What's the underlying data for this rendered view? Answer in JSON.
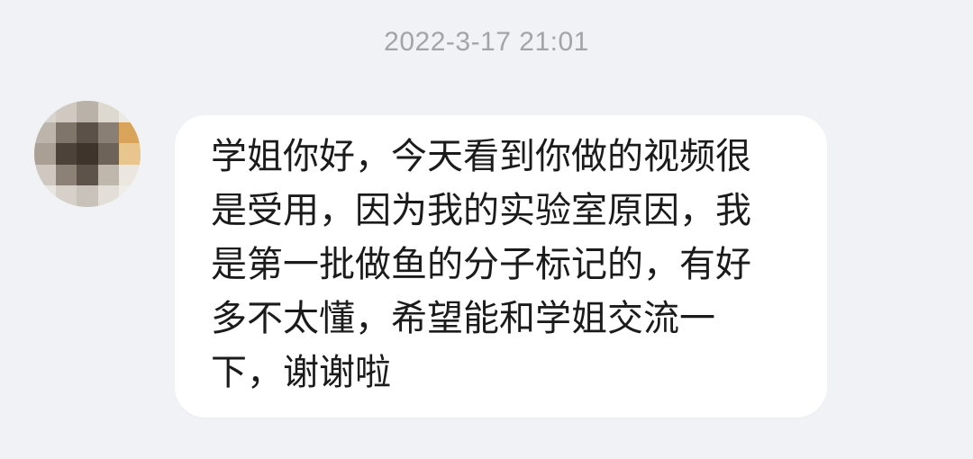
{
  "chat": {
    "timestamp": "2022-3-17 21:01",
    "message": {
      "lines": [
        "学姐你好，今天看到你做的视频很",
        "是受用，因为我的实验室原因，我",
        "是第一批做鱼的分子标记的，有好",
        "多不太懂，希望能和学姐交流一",
        "下，谢谢啦"
      ]
    },
    "avatar": {
      "icon": "pixelated-avatar-icon",
      "mosaic_colors": [
        "#d8d4cf",
        "#cfc9c1",
        "#b9b2a8",
        "#ddd8d0",
        "#ece8e2",
        "#bdb5ab",
        "#7f756b",
        "#5c5148",
        "#8a7f74",
        "#d9a45a",
        "#a99f95",
        "#4d4239",
        "#3f342c",
        "#6e6358",
        "#e8c58c",
        "#cfc8c0",
        "#8b8177",
        "#5e534a",
        "#bfb6ac",
        "#ebe6df",
        "#e9e5e0",
        "#d6d0c9",
        "#c9c2ba",
        "#e3ded8",
        "#f0ece7"
      ]
    }
  },
  "colors": {
    "background": "#f1f2f6",
    "bubble": "#ffffff",
    "text": "#1b1b1b",
    "timestamp": "#a3a4a8"
  }
}
